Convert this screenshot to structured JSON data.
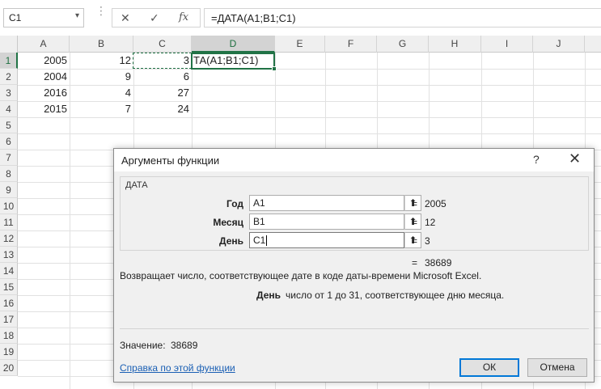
{
  "formula_bar": {
    "name_box": "C1",
    "cancel_glyph": "✕",
    "enter_glyph": "✓",
    "fx_label": "fx",
    "formula": "=ДАТА(A1;B1;C1)"
  },
  "grid": {
    "columns": [
      "A",
      "B",
      "C",
      "D",
      "E",
      "F",
      "G",
      "H",
      "I",
      "J"
    ],
    "rows": [
      "1",
      "2",
      "3",
      "4",
      "5",
      "6",
      "7",
      "8",
      "9",
      "10",
      "11",
      "12",
      "13",
      "14",
      "15",
      "16",
      "17",
      "18",
      "19",
      "20"
    ],
    "cells": {
      "A1": "2005",
      "B1": "12",
      "C1": "3",
      "A2": "2004",
      "B2": "9",
      "C2": "6",
      "A3": "2016",
      "B3": "4",
      "C3": "27",
      "A4": "2015",
      "B4": "7",
      "C4": "24"
    },
    "active_cell_text": "ТА(A1;B1;C1)",
    "active_cell_prefix": "Т"
  },
  "dialog": {
    "title": "Аргументы функции",
    "help_glyph": "?",
    "close_glyph": "✕",
    "function_name": "ДАТА",
    "args": [
      {
        "label": "Год",
        "value": "A1",
        "eq": "=",
        "result": "2005"
      },
      {
        "label": "Месяц",
        "value": "B1",
        "eq": "=",
        "result": "12"
      },
      {
        "label": "День",
        "value": "C1",
        "eq": "=",
        "result": "3"
      }
    ],
    "ref_glyph": "⬆",
    "result_eq": "=",
    "result_value": "38689",
    "description": "Возвращает число, соответствующее дате в коде даты-времени Microsoft Excel.",
    "arg_desc_name": "День",
    "arg_desc_text": "число от 1 до 31, соответствующее дню месяца.",
    "value_label": "Значение:",
    "value_num": "38689",
    "help_link": "Справка по этой функции",
    "ok_label": "ОК",
    "cancel_label": "Отмена"
  },
  "colors": {
    "excel_green": "#217346",
    "link_blue": "#1a5fb4",
    "focus_blue": "#0078d7"
  }
}
